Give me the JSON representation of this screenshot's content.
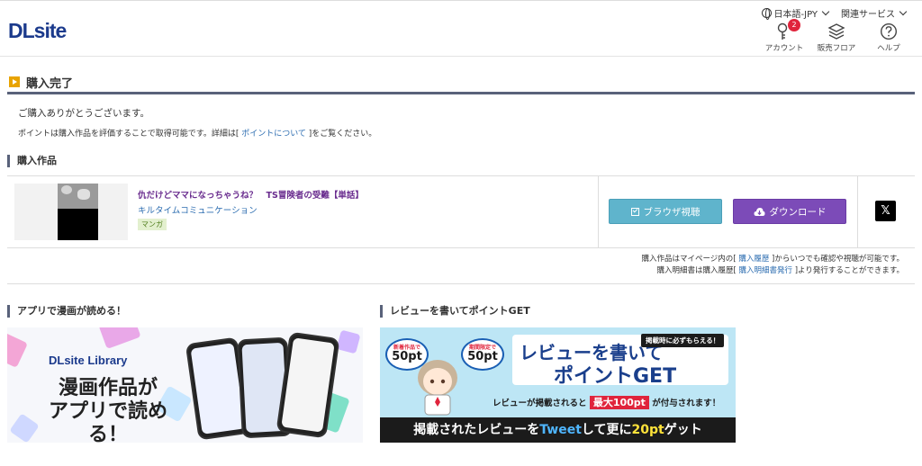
{
  "header": {
    "logo": "DLsite",
    "language": "日本語-JPY",
    "related": "関連サービス",
    "account_label": "アカウント",
    "account_badge": "2",
    "floor_label": "販売フロア",
    "help_label": "ヘルプ"
  },
  "page": {
    "title": "購入完了",
    "thanks": "ご購入ありがとうございます。",
    "points_pre": "ポイントは購入作品を評価することで取得可能です。詳細は[",
    "points_link": " ポイントについて ",
    "points_post": "]をご覧ください。"
  },
  "purchased": {
    "section_title": "購入作品",
    "product": {
      "title": "仇だけどママになっちゃうね？　TS冒険者の受難【単話】",
      "maker": "キルタイムコミュニケーション",
      "tag": "マンガ"
    },
    "browser_button": "ブラウザ視聴",
    "download_button": "ダウンロード",
    "share_label": "𝕏"
  },
  "notes": {
    "line1_pre": "購入作品はマイページ内の[",
    "line1_link": " 購入履歴 ",
    "line1_post": "]からいつでも確認や視聴が可能です。",
    "line2_pre": "購入明細書は購入履歴[",
    "line2_link": " 購入明細書発行 ",
    "line2_post": "]より発行することができます。"
  },
  "promos": {
    "app_title": "アプリで漫画が読める！",
    "app_logo": "DLsite Library",
    "app_text_1": "漫画作品が",
    "app_text_2": "アプリで読める！",
    "review_title": "レビューを書いてポイントGET",
    "bubble1_small": "新着作品で",
    "bubble1_big": "50pt",
    "bubble2_small": "期間限定で",
    "bubble2_big": "50pt",
    "review_head_1": "レビューを書いて",
    "review_head_2": "ポイントGET",
    "review_label": "掲載時に必ずもらえる！",
    "review_line_pre": "レビューが掲載されると",
    "review_line_hl": "最大100pt",
    "review_line_post": "が付与されます！",
    "review_bottom_pre": "掲載されたレビューを",
    "review_bottom_tw": "Tweet",
    "review_bottom_mid": "して更に",
    "review_bottom_pt": "20pt",
    "review_bottom_post": "ゲット"
  }
}
